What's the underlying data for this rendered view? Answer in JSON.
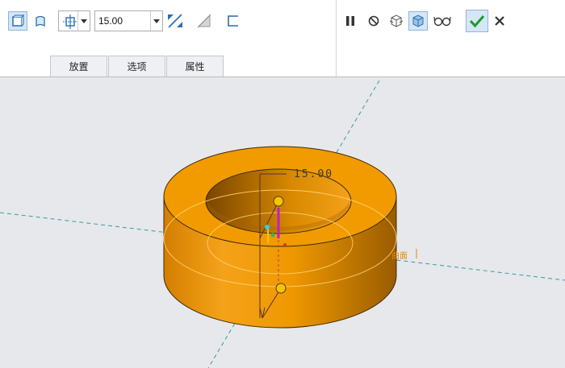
{
  "toolbar": {
    "depth_value": "15.00",
    "icons": [
      "solid-icon",
      "surface-icon",
      "depth-option-icon",
      "flip-direction-icon",
      "remove-material-icon",
      "thicken-icon"
    ]
  },
  "tabs": [
    {
      "label": "放置"
    },
    {
      "label": "选项"
    },
    {
      "label": "属性"
    }
  ],
  "controls": {
    "icons": [
      "pause-icon",
      "no-preview-icon",
      "geometry-preview-icon",
      "feature-preview-icon",
      "verify-icon",
      "ok-icon",
      "cancel-icon"
    ]
  },
  "canvas": {
    "dimension": "15.00",
    "surface_label": "曲面",
    "colors": {
      "body": "#f29b00",
      "axis": "#3a9a9a",
      "handle": "#f5c400",
      "drag_handle": "#c020c0"
    }
  }
}
